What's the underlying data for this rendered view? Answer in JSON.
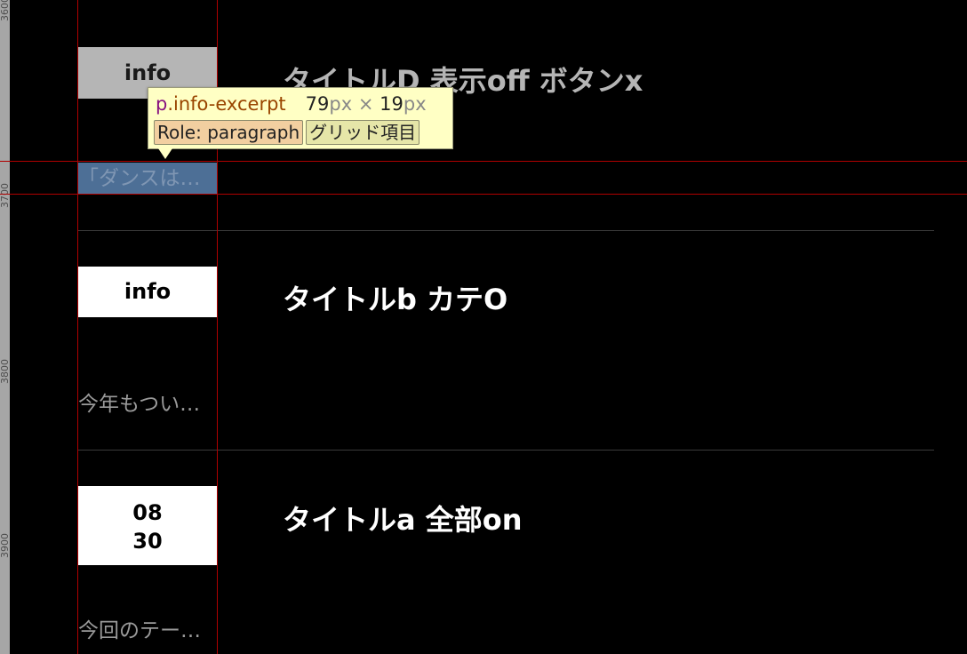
{
  "ruler": {
    "labels": [
      "3600",
      "3700",
      "3800",
      "3900"
    ]
  },
  "items": [
    {
      "badge": "info",
      "title": "タイトルD 表示off ボタンx",
      "excerpt": "「ダンスは…"
    },
    {
      "badge": "info",
      "title": "タイトルb カテO",
      "excerpt": "今年もつい…"
    },
    {
      "badge_lines": [
        "08",
        "30"
      ],
      "title": "タイトルa 全部on",
      "excerpt": "今回のテー…"
    }
  ],
  "tooltip": {
    "tag": "p",
    "class_name": ".info-excerpt",
    "width": "79",
    "unit": "px",
    "times": "×",
    "height": "19",
    "role_label": "Role: paragraph",
    "grid_label": "グリッド項目"
  },
  "colors": {
    "guide": "#b00000",
    "highlight": "#4d6f96",
    "tooltip_bg": "#ffffc4"
  }
}
